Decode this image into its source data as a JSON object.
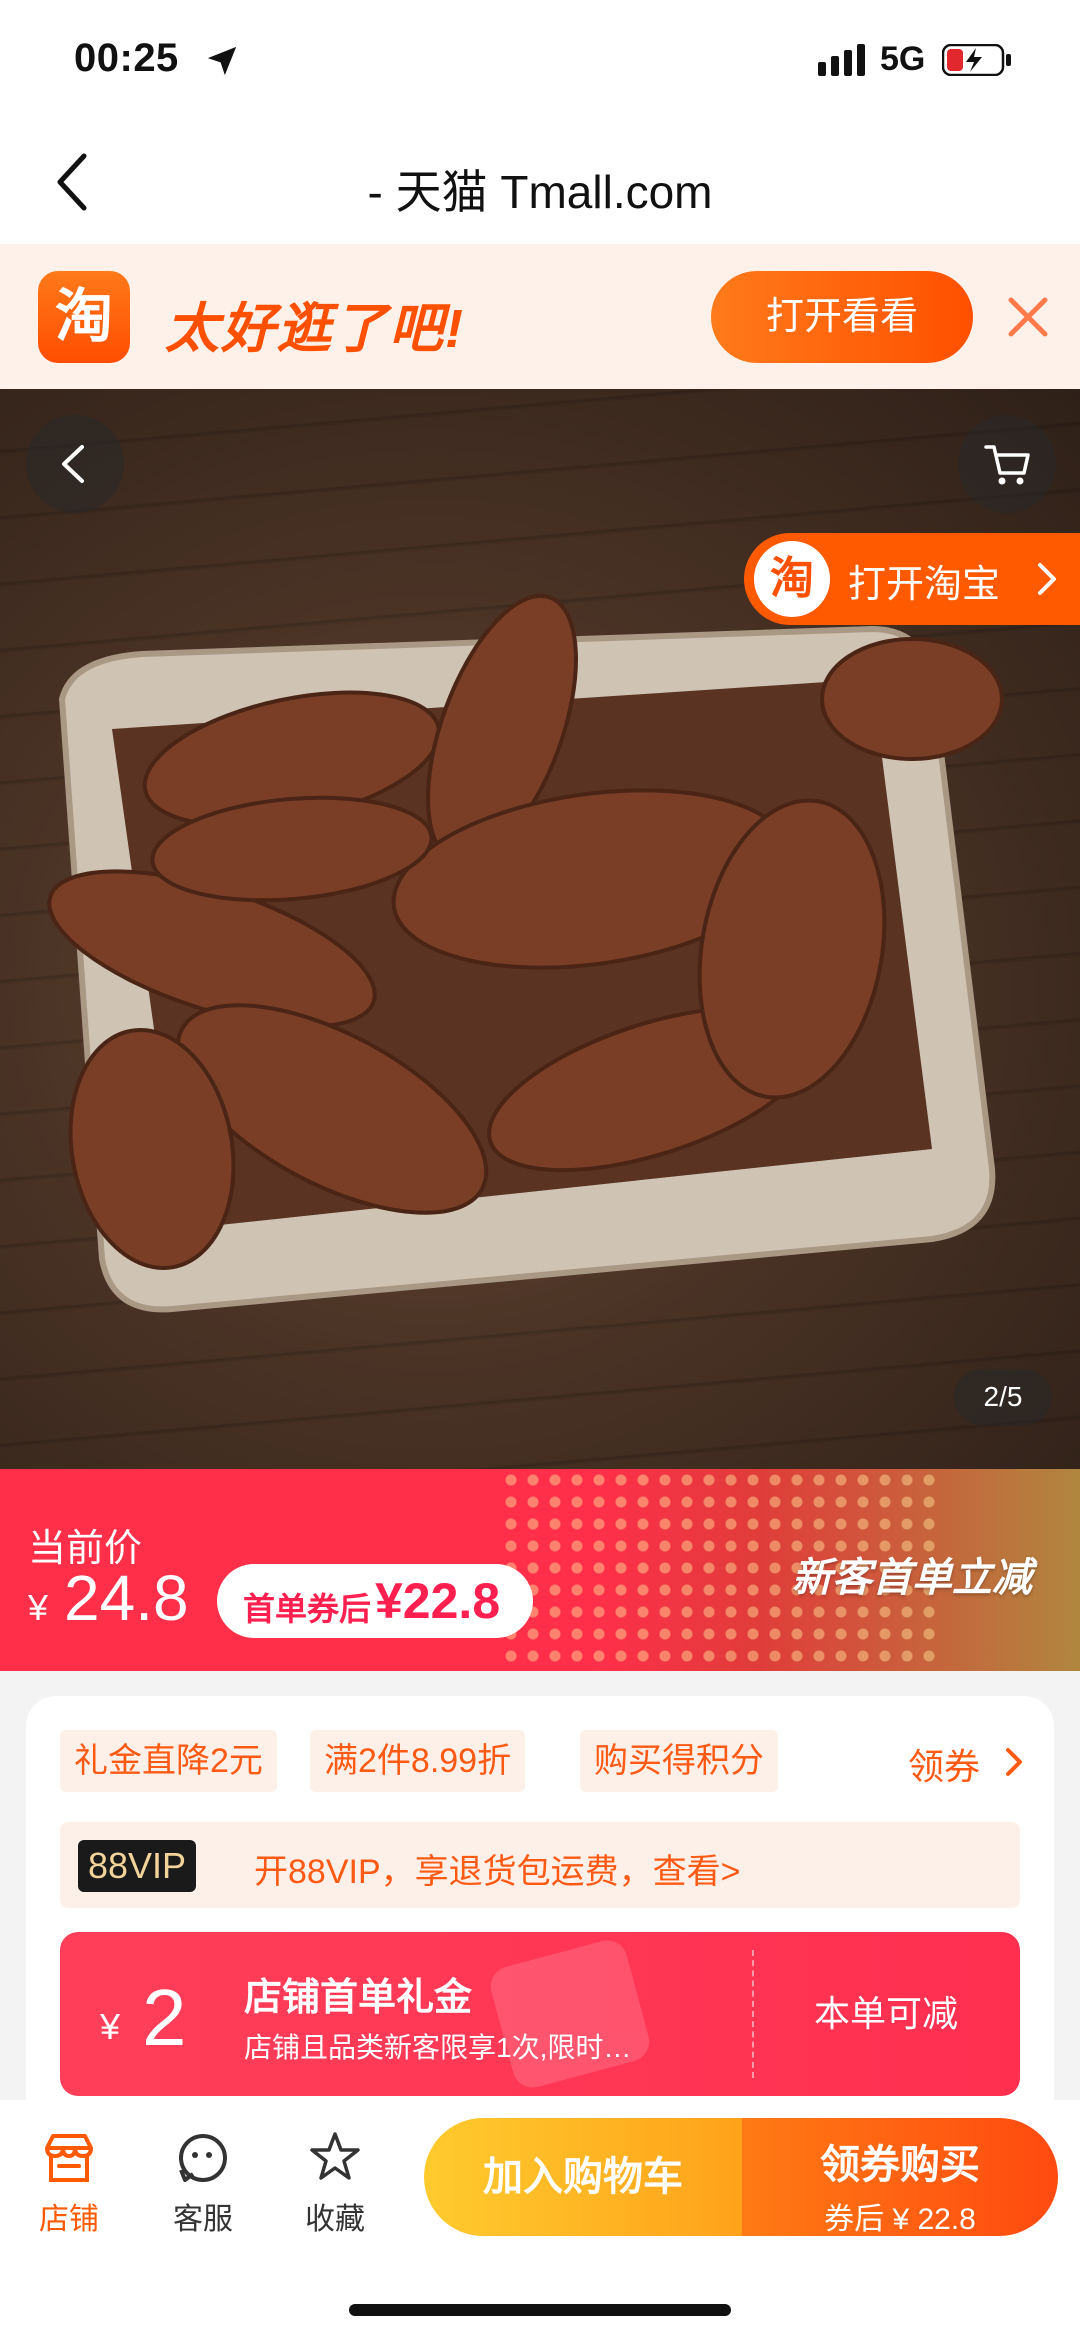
{
  "status_bar": {
    "time": "00:25",
    "network": "5G"
  },
  "nav": {
    "title": "- 天猫 Tmall.com"
  },
  "promo": {
    "logo_char": "淘",
    "slogan": "太好逛了吧!",
    "open_label": "打开看看"
  },
  "hero": {
    "open_taobao_icon": "淘",
    "open_taobao_label": "打开淘宝",
    "image_counter": "2/5"
  },
  "price": {
    "current_label": "当前价",
    "currency": "¥",
    "amount": "24.8",
    "coupon_text": "首单券后",
    "coupon_value": "¥22.8",
    "newbie_text": "新客首单立减"
  },
  "promos": {
    "tags": [
      "礼金直降2元",
      "满2件8.99折",
      "购买得积分"
    ],
    "get_coupon": "领券"
  },
  "vip": {
    "badge": "88VIP",
    "text": "开88VIP，享退货包运费，查看>"
  },
  "gift": {
    "currency": "¥",
    "amount": "2",
    "title": "店铺首单礼金",
    "desc": "店铺且品类新客限享1次,限时…",
    "cta": "本单可减"
  },
  "bottom_bar": {
    "tabs": [
      {
        "label": "店铺",
        "icon": "shop-icon"
      },
      {
        "label": "客服",
        "icon": "service-icon"
      },
      {
        "label": "收藏",
        "icon": "star-icon"
      }
    ],
    "add_to_cart": "加入购物车",
    "buy_label": "领券购买",
    "buy_sub": "券后 ¥ 22.8"
  },
  "colors": {
    "accent": "#ff5000",
    "price_red": "#ff2f4a",
    "vip_gold": "#f2d49a"
  }
}
